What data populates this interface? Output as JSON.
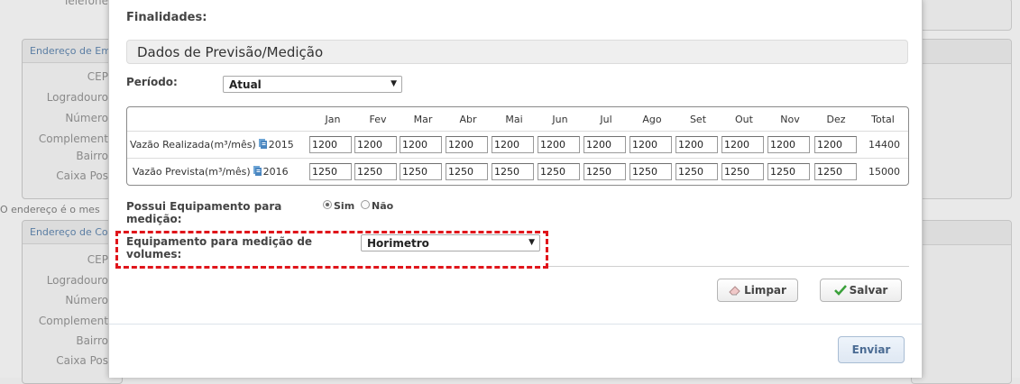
{
  "background": {
    "telefone_label": "Telefone",
    "panel1_title": "Endereço de Emp",
    "panel1_fields": [
      "CEP",
      "Logradouro",
      "Número",
      "Complement",
      "Bairro",
      "Caixa Pos"
    ],
    "note": "O endereço é o mes",
    "panel2_title": "Endereço de Corr",
    "panel2_fields": [
      "CEP",
      "Logradouro",
      "Número",
      "Complement",
      "Bairro",
      "Caixa Pos"
    ]
  },
  "modal": {
    "finalidades_label": "Finalidades:",
    "section_title": "Dados de Previsão/Medição",
    "periodo": {
      "label": "Período:",
      "value": "Atual"
    },
    "table": {
      "headers": [
        "Jan",
        "Fev",
        "Mar",
        "Abr",
        "Mai",
        "Jun",
        "Jul",
        "Ago",
        "Set",
        "Out",
        "Nov",
        "Dez",
        "Total"
      ],
      "rows": [
        {
          "label": "Vazão Realizada(m³/mês)",
          "year": "2015",
          "values": [
            "1200",
            "1200",
            "1200",
            "1200",
            "1200",
            "1200",
            "1200",
            "1200",
            "1200",
            "1200",
            "1200",
            "1200"
          ],
          "total": "14400",
          "icon": "document-icon"
        },
        {
          "label": "Vazão Prevista(m³/mês)",
          "year": "2016",
          "values": [
            "1250",
            "1250",
            "1250",
            "1250",
            "1250",
            "1250",
            "1250",
            "1250",
            "1250",
            "1250",
            "1250",
            "1250"
          ],
          "total": "15000",
          "icon": "document-icon"
        }
      ]
    },
    "possui_equipamento": {
      "label": "Possui Equipamento para medição:",
      "options": [
        "Sim",
        "Não"
      ],
      "selected": "Sim"
    },
    "equipamento": {
      "label": "Equipamento para medição de volumes:",
      "value": "Horimetro"
    },
    "buttons": {
      "limpar": "Limpar",
      "salvar": "Salvar",
      "enviar": "Enviar"
    },
    "colors": {
      "highlight_dashed": "#e0151b",
      "salvar_check": "#3aa03a",
      "enviar_text": "#4a6b93"
    }
  }
}
